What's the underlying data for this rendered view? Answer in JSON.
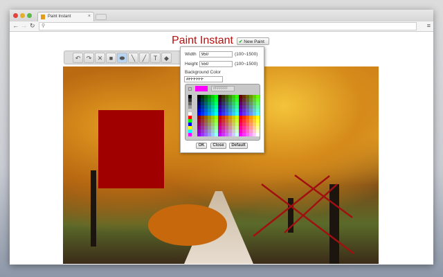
{
  "browser": {
    "tab_title": "Paint Instant",
    "address": ""
  },
  "page": {
    "title": "Paint Instant",
    "new_paint_label": "New Paint"
  },
  "tools": [
    {
      "icon": "undo-icon",
      "glyph": "↶"
    },
    {
      "icon": "redo-icon",
      "glyph": "↷"
    },
    {
      "icon": "clear-icon",
      "glyph": "✕"
    },
    {
      "icon": "rectangle-icon",
      "glyph": "■"
    },
    {
      "icon": "ellipse-icon",
      "glyph": "⬬",
      "active": true
    },
    {
      "icon": "line-icon",
      "glyph": "╲"
    },
    {
      "icon": "pencil-icon",
      "glyph": "╱"
    },
    {
      "icon": "text-icon",
      "glyph": "T"
    },
    {
      "icon": "eraser-icon",
      "glyph": "◆"
    }
  ],
  "dialog": {
    "width_label": "Width",
    "width_value": "950",
    "width_range": "(100~1500)",
    "height_label": "Height",
    "height_value": "550",
    "height_range": "(100~1500)",
    "bg_label": "Background Color",
    "bg_value": "#FFFFFF",
    "picker_hex": "#FFFFFF",
    "picker_selected": "#ff00ff",
    "ok": "OK",
    "close": "Close",
    "default": "Default"
  },
  "shapes": {
    "rect_color": "#a00000",
    "ellipse_color": "#c8680c",
    "cross_color": "#a01010"
  }
}
